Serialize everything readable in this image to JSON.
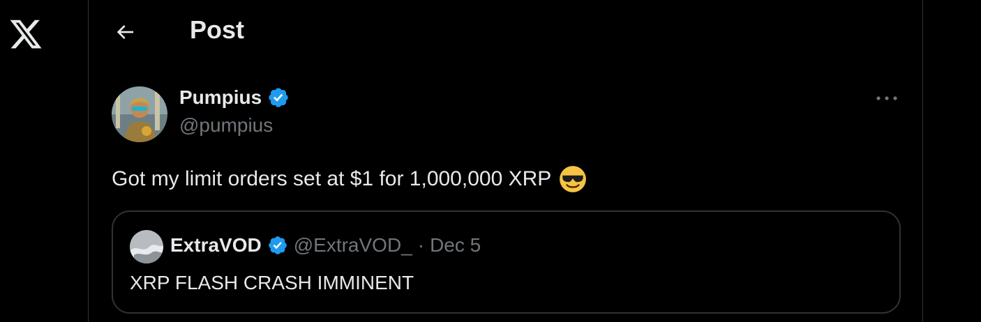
{
  "header": {
    "title": "Post"
  },
  "post": {
    "author": {
      "display_name": "Pumpius",
      "handle": "@pumpius",
      "verified": true
    },
    "text": "Got my limit orders set at $1 for 1,000,000 XRP",
    "emoji": "smiling-face-with-sunglasses"
  },
  "quoted_post": {
    "author": {
      "display_name": "ExtraVOD",
      "handle": "@ExtraVOD_",
      "verified": true
    },
    "separator": "·",
    "date": "Dec 5",
    "text": "XRP FLASH CRASH IMMINENT"
  },
  "colors": {
    "background": "#000000",
    "text_primary": "#e7e9ea",
    "text_secondary": "#71767b",
    "border": "#2f3336",
    "verified_blue": "#1d9bf0"
  },
  "icons": [
    "x-logo-icon",
    "back-arrow-icon",
    "verified-badge-icon",
    "more-options-icon"
  ]
}
